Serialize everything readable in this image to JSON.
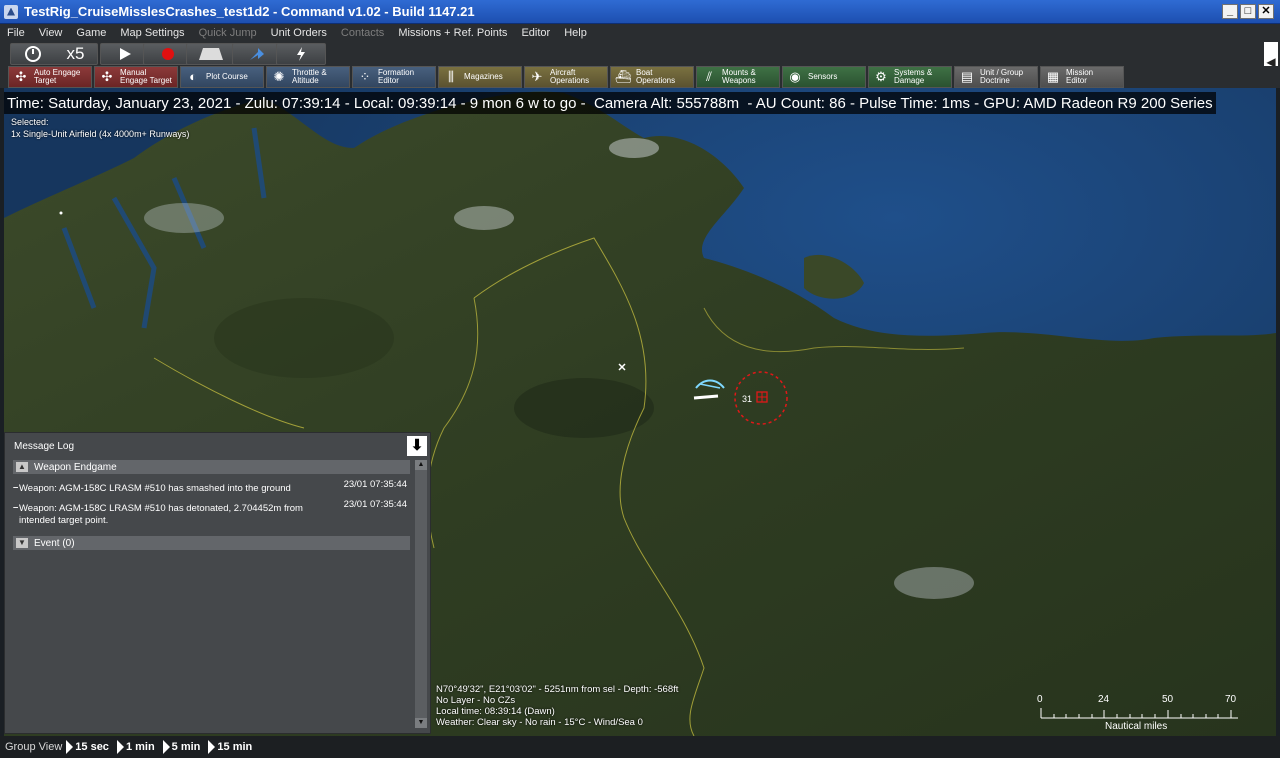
{
  "window": {
    "title": "TestRig_CruiseMisslesCrashes_test1d2 - Command v1.02 - Build 1147.21",
    "controls": [
      "_",
      "□",
      "✕"
    ]
  },
  "menu": [
    {
      "label": "File",
      "enabled": true
    },
    {
      "label": "View",
      "enabled": true
    },
    {
      "label": "Game",
      "enabled": true
    },
    {
      "label": "Map Settings",
      "enabled": true
    },
    {
      "label": "Quick Jump",
      "enabled": false
    },
    {
      "label": "Unit Orders",
      "enabled": true
    },
    {
      "label": "Contacts",
      "enabled": false
    },
    {
      "label": "Missions + Ref. Points",
      "enabled": true
    },
    {
      "label": "Editor",
      "enabled": true
    },
    {
      "label": "Help",
      "enabled": true
    }
  ],
  "time_controls": {
    "compression": "x5",
    "buttons": [
      "clock-icon",
      "play-icon",
      "record-icon",
      "laptop-icon",
      "jump-icon",
      "lightning-icon"
    ]
  },
  "toolbar": [
    {
      "label": "Auto Engage\nTarget",
      "icon": "target-icon",
      "color": "#8c3a3a"
    },
    {
      "label": "Manual\nEngage Target",
      "icon": "target-icon",
      "color": "#8c3a3a"
    },
    {
      "label": "Plot Course",
      "icon": "course-icon",
      "color": "#48607e"
    },
    {
      "label": "Throttle &\nAltitude",
      "icon": "throttle-icon",
      "color": "#48607e"
    },
    {
      "label": "Formation\nEditor",
      "icon": "formation-icon",
      "color": "#48607e"
    },
    {
      "label": "Magazines",
      "icon": "magazine-icon",
      "color": "#7a7140"
    },
    {
      "label": "Aircraft\nOperations",
      "icon": "aircraft-icon",
      "color": "#7a7140"
    },
    {
      "label": "Boat\nOperations",
      "icon": "boat-icon",
      "color": "#7a7140"
    },
    {
      "label": "Mounts &\nWeapons",
      "icon": "weapons-icon",
      "color": "#3f7145"
    },
    {
      "label": "Sensors",
      "icon": "sensor-icon",
      "color": "#3f7145"
    },
    {
      "label": "Systems &\nDamage",
      "icon": "gear-icon",
      "color": "#3f7145"
    },
    {
      "label": "Unit / Group\nDoctrine",
      "icon": "doctrine-icon",
      "color": "#6a6a6a"
    },
    {
      "label": "Mission\nEditor",
      "icon": "mission-icon",
      "color": "#6a6a6a"
    }
  ],
  "status": {
    "line": "Time: Saturday, January 23, 2021 - Zulu: 07:39:14 - Local: 09:39:14 - 9 mon 6 w to go -  Camera Alt: 555788m  - AU Count: 86 - Pulse Time: 1ms - GPU: AMD Radeon R9 200 Series",
    "selected_label": "Selected:",
    "selected_value": "1x Single-Unit Airfield (4x 4000m+ Runways)"
  },
  "map": {
    "contact_count": "31"
  },
  "message_log": {
    "title": "Message Log",
    "groups": [
      {
        "name": "Weapon Endgame",
        "expanded": true,
        "messages": [
          {
            "text": "Weapon: AGM-158C LRASM #510 has smashed into the ground",
            "time": "23/01 07:35:44"
          },
          {
            "text": "Weapon: AGM-158C LRASM #510 has detonated, 2.704452m from intended target point.",
            "time": "23/01 07:35:44"
          }
        ]
      },
      {
        "name": "Event (0)",
        "expanded": false,
        "messages": []
      }
    ]
  },
  "map_info": {
    "position": "N70°49'32\", E21°03'02\" - 5251nm from sel - Depth: -568ft",
    "layer": "No Layer - No CZs",
    "local_time": "Local time: 08:39:14 (Dawn)",
    "weather": "Weather: Clear sky - No rain - 15°C - Wind/Sea 0"
  },
  "scale": {
    "ticks": [
      "0",
      "24",
      "50",
      "70"
    ],
    "unit": "Nautical miles"
  },
  "bottom": {
    "group_view": "Group View",
    "steps": [
      "15 sec",
      "1 min",
      "5 min",
      "15 min"
    ]
  }
}
